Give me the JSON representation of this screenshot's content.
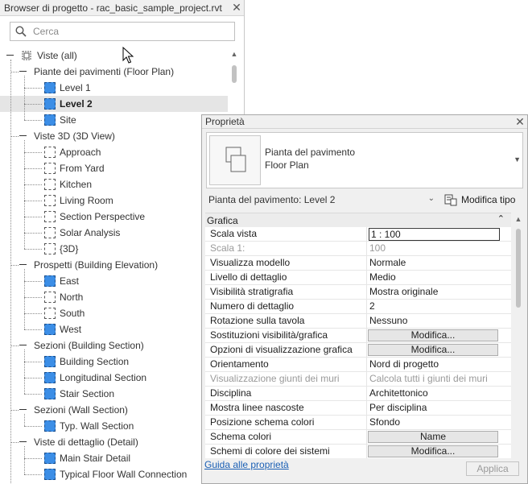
{
  "browser": {
    "title": "Browser di progetto - rac_basic_sample_project.rvt",
    "search_placeholder": "Cerca",
    "tree": [
      {
        "label": "Viste (all)",
        "level": 0,
        "kind": "root"
      },
      {
        "label": "Piante dei pavimenti (Floor Plan)",
        "level": 1,
        "kind": "group"
      },
      {
        "label": "Level 1",
        "level": 2,
        "kind": "view",
        "icon": "floor-plan-view-icon"
      },
      {
        "label": "Level 2",
        "level": 2,
        "kind": "view",
        "icon": "floor-plan-view-icon",
        "selected": true
      },
      {
        "label": "Site",
        "level": 2,
        "kind": "view",
        "icon": "floor-plan-view-icon"
      },
      {
        "label": "Viste 3D (3D View)",
        "level": 1,
        "kind": "group"
      },
      {
        "label": "Approach",
        "level": 2,
        "kind": "view",
        "icon": "3d-view-icon"
      },
      {
        "label": "From Yard",
        "level": 2,
        "kind": "view",
        "icon": "3d-view-icon"
      },
      {
        "label": "Kitchen",
        "level": 2,
        "kind": "view",
        "icon": "3d-view-icon"
      },
      {
        "label": "Living Room",
        "level": 2,
        "kind": "view",
        "icon": "3d-view-icon"
      },
      {
        "label": "Section Perspective",
        "level": 2,
        "kind": "view",
        "icon": "3d-view-icon"
      },
      {
        "label": "Solar Analysis",
        "level": 2,
        "kind": "view",
        "icon": "3d-view-icon"
      },
      {
        "label": "{3D}",
        "level": 2,
        "kind": "view",
        "icon": "3d-view-icon"
      },
      {
        "label": "Prospetti (Building Elevation)",
        "level": 1,
        "kind": "group"
      },
      {
        "label": "East",
        "level": 2,
        "kind": "view",
        "icon": "elevation-view-icon"
      },
      {
        "label": "North",
        "level": 2,
        "kind": "view",
        "icon": "elevation-view-icon"
      },
      {
        "label": "South",
        "level": 2,
        "kind": "view",
        "icon": "elevation-view-icon"
      },
      {
        "label": "West",
        "level": 2,
        "kind": "view",
        "icon": "elevation-view-icon"
      },
      {
        "label": "Sezioni (Building Section)",
        "level": 1,
        "kind": "group"
      },
      {
        "label": "Building Section",
        "level": 2,
        "kind": "view",
        "icon": "section-view-icon"
      },
      {
        "label": "Longitudinal Section",
        "level": 2,
        "kind": "view",
        "icon": "section-view-icon"
      },
      {
        "label": "Stair Section",
        "level": 2,
        "kind": "view",
        "icon": "section-view-icon"
      },
      {
        "label": "Sezioni (Wall Section)",
        "level": 1,
        "kind": "group"
      },
      {
        "label": "Typ. Wall Section",
        "level": 2,
        "kind": "view",
        "icon": "section-view-icon"
      },
      {
        "label": "Viste di dettaglio (Detail)",
        "level": 1,
        "kind": "group"
      },
      {
        "label": "Main Stair Detail",
        "level": 2,
        "kind": "view",
        "icon": "detail-view-icon"
      },
      {
        "label": "Typical Floor Wall Connection",
        "level": 2,
        "kind": "view",
        "icon": "detail-view-icon"
      }
    ]
  },
  "properties": {
    "title": "Proprietà",
    "type_line1": "Pianta del pavimento",
    "type_line2": "Floor Plan",
    "instance_selector": "Pianta del pavimento: Level 2",
    "edit_type_label": "Modifica tipo",
    "section_header": "Grafica",
    "rows": [
      {
        "name": "Scala vista",
        "value": "1 : 100",
        "style": "boxed"
      },
      {
        "name": "Scala  1:",
        "value": "100",
        "style": "disabled"
      },
      {
        "name": "Visualizza modello",
        "value": "Normale"
      },
      {
        "name": "Livello di dettaglio",
        "value": "Medio"
      },
      {
        "name": "Visibilità stratigrafia",
        "value": "Mostra originale"
      },
      {
        "name": "Numero di dettaglio",
        "value": "2"
      },
      {
        "name": "Rotazione sulla tavola",
        "value": "Nessuno"
      },
      {
        "name": "Sostituzioni visibilità/grafica",
        "value": "Modifica...",
        "style": "button"
      },
      {
        "name": "Opzioni di visualizzazione grafica",
        "value": "Modifica...",
        "style": "button"
      },
      {
        "name": "Orientamento",
        "value": "Nord di progetto"
      },
      {
        "name": "Visualizzazione giunti dei muri",
        "value": "Calcola tutti i giunti dei muri",
        "style": "disabled"
      },
      {
        "name": "Disciplina",
        "value": "Architettonico"
      },
      {
        "name": "Mostra linee nascoste",
        "value": "Per disciplina"
      },
      {
        "name": "Posizione schema colori",
        "value": "Sfondo"
      },
      {
        "name": "Schema colori",
        "value": "Name",
        "style": "button"
      },
      {
        "name": "Schemi di colore dei sistemi",
        "value": "Modifica...",
        "style": "button"
      }
    ],
    "help_link": "Guida alle proprietà",
    "apply_label": "Applica"
  },
  "colors": {
    "view_icon_blue": "#3c8ee6",
    "selected_row": "#e5e5e5",
    "link": "#1a5fb4"
  }
}
